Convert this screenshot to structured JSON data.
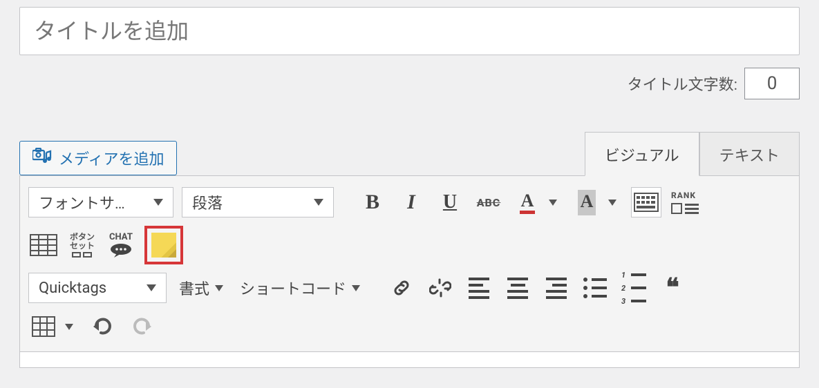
{
  "title": {
    "placeholder": "タイトルを追加",
    "value": ""
  },
  "title_count": {
    "label": "タイトル文字数:",
    "value": "0"
  },
  "media_button": "メディアを追加",
  "tabs": {
    "visual": "ビジュアル",
    "text": "テキスト"
  },
  "selects": {
    "fontsize": "フォントサ…",
    "paragraph": "段落",
    "quicktags": "Quicktags"
  },
  "row1": {
    "bold": "B",
    "italic": "I",
    "underline": "U",
    "strike": "ABC",
    "textcolor": "A",
    "bgcolor": "A",
    "rank": "RANK"
  },
  "row2": {
    "btnset_l1": "ボタン",
    "btnset_l2": "セット",
    "chat": "CHAT"
  },
  "row3": {
    "format": "書式",
    "shortcode": "ショートコード"
  }
}
